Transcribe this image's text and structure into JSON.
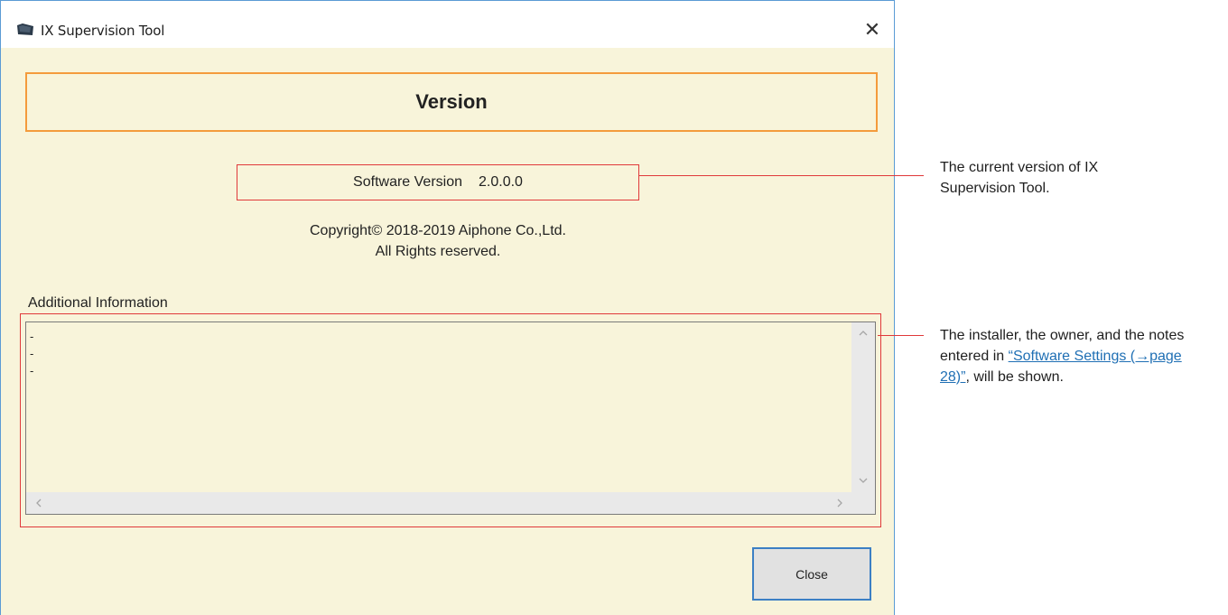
{
  "window": {
    "title": "IX Supervision Tool",
    "close_glyph": "✕"
  },
  "banner": {
    "title": "Version"
  },
  "software_version": {
    "label": "Software Version",
    "value": "2.0.0.0"
  },
  "copyright": {
    "line1": "Copyright© 2018-2019 Aiphone Co.,Ltd.",
    "line2": "All Rights reserved."
  },
  "additional_info": {
    "label": "Additional Information",
    "lines": [
      "-",
      "-",
      "-"
    ]
  },
  "buttons": {
    "close_label": "Close"
  },
  "annotations": {
    "version_note": "The current version of IX Supervision Tool.",
    "info_note_prefix": "The installer, the owner, and the notes entered in ",
    "info_note_link": "“Software Settings (→page 28)”",
    "info_note_suffix": ", will be shown."
  },
  "icons": {
    "app": "app-icon",
    "close": "close-icon",
    "scroll_up": "chevron-up-icon",
    "scroll_down": "chevron-down-icon",
    "scroll_left": "chevron-left-icon",
    "scroll_right": "chevron-right-icon"
  },
  "colors": {
    "window_bg": "#f8f4da",
    "banner_border": "#f49b3c",
    "highlight_red": "#e0393a",
    "link_blue": "#1f6fb4",
    "button_focus": "#3c7fc4"
  }
}
